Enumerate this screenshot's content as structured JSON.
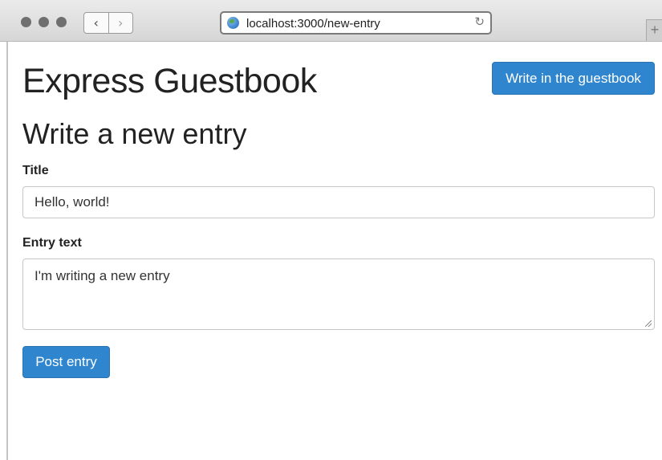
{
  "browser": {
    "url": "localhost:3000/new-entry",
    "back_glyph": "‹",
    "forward_glyph": "›",
    "reload_glyph": "↻",
    "new_tab_glyph": "+",
    "icons": [
      "back-icon",
      "forward-icon",
      "globe-icon",
      "reload-icon",
      "new-tab-icon"
    ]
  },
  "header": {
    "title": "Express Guestbook",
    "action_label": "Write in the guestbook"
  },
  "form": {
    "heading": "Write a new entry",
    "title_label": "Title",
    "title_value": "Hello, world!",
    "text_label": "Entry text",
    "text_value": "I'm writing a new entry",
    "submit_label": "Post entry"
  },
  "colors": {
    "primary_button": "#2f86cf"
  }
}
